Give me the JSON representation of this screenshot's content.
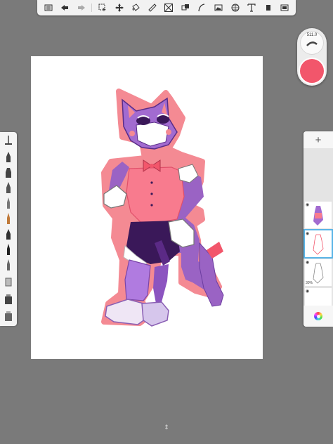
{
  "toolbar": {
    "icons": [
      "gallery-icon",
      "undo-icon",
      "redo-icon",
      "select-icon",
      "transform-icon",
      "fill-icon",
      "ruler-icon",
      "symmetry-icon",
      "style-icon",
      "curve-icon",
      "image-icon",
      "perspective-icon",
      "text-icon",
      "layers-icon",
      "window-icon"
    ]
  },
  "brush_puck": {
    "size_label": "511.0",
    "current_color": "#f2566b"
  },
  "layers": {
    "add_label": "+",
    "items": [
      {
        "name": "layer-colored",
        "opacity": ""
      },
      {
        "name": "layer-lineart",
        "opacity": ""
      },
      {
        "name": "layer-sketch",
        "opacity": "30%"
      },
      {
        "name": "layer-background",
        "opacity": ""
      }
    ]
  },
  "brushes": [
    "pencil",
    "ballpoint",
    "marker",
    "brush",
    "airbrush",
    "chisel",
    "fine-liner",
    "ink",
    "felt-tip",
    "eraser",
    "smudge",
    "blender"
  ],
  "bottom_handle": "⇕"
}
